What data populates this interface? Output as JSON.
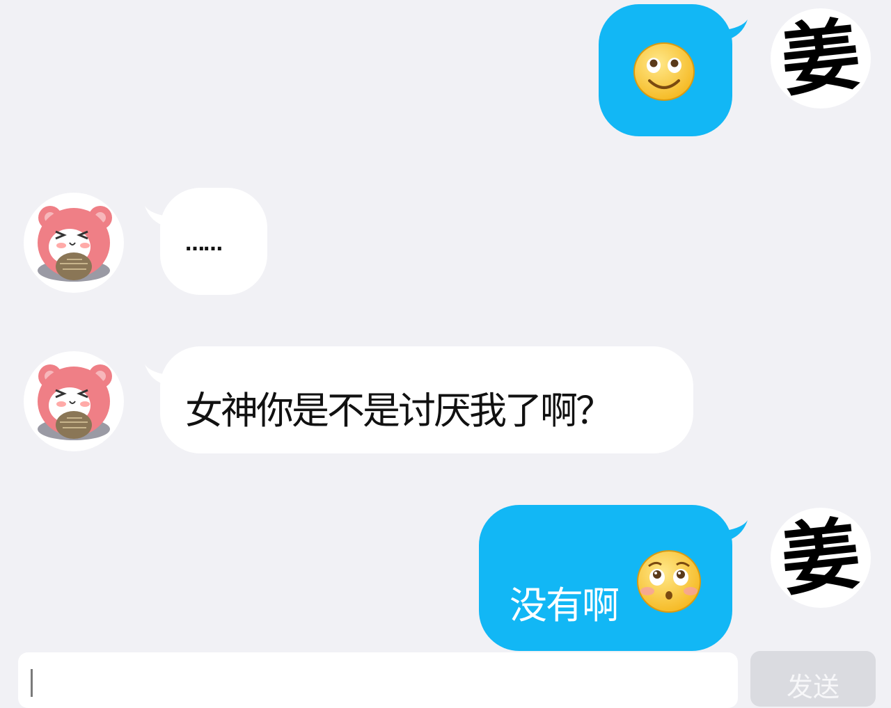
{
  "chat": {
    "messages": [
      {
        "sender": "me",
        "text": "",
        "emoji": "smile-emoji",
        "avatar": "jiang-calligraphy-avatar"
      },
      {
        "sender": "them",
        "text": "……",
        "avatar": "pink-hamster-avatar"
      },
      {
        "sender": "them",
        "text": "女神你是不是讨厌我了啊？",
        "avatar": "pink-hamster-avatar"
      },
      {
        "sender": "me",
        "text": "没有啊",
        "emoji": "pleading-blush-emoji",
        "avatar": "jiang-calligraphy-avatar"
      }
    ],
    "my_avatar_char": "姜"
  },
  "composer": {
    "value": "",
    "send_label": "发送"
  },
  "colors": {
    "background": "#f1f1f5",
    "my_bubble": "#12b7f5",
    "their_bubble": "#ffffff",
    "send_button": "#dadbe0"
  }
}
